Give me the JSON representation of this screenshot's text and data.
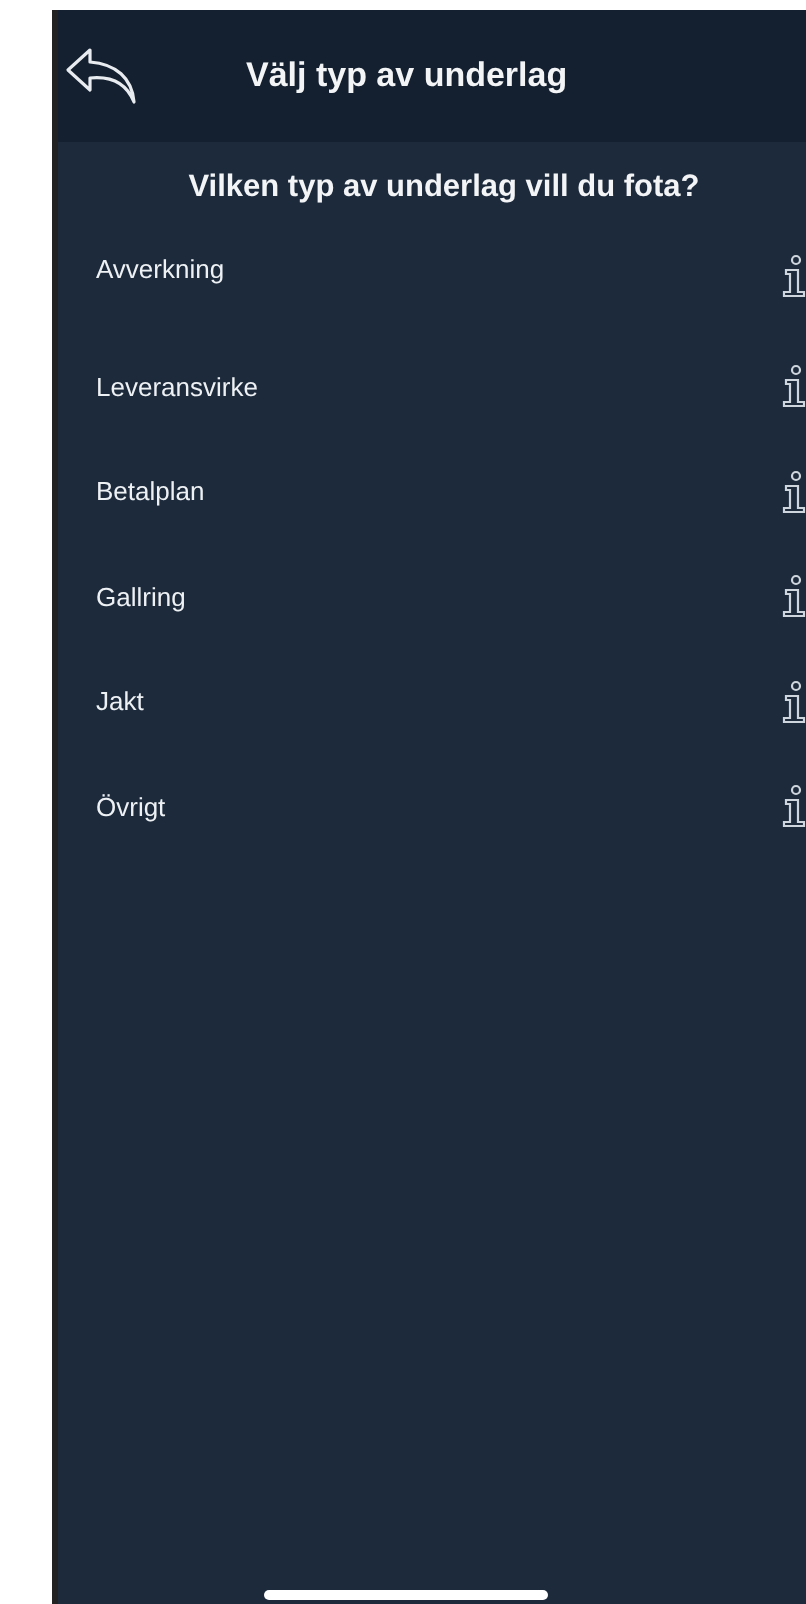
{
  "header": {
    "title": "Välj typ av underlag"
  },
  "question": "Vilken typ av underlag vill du fota?",
  "items": [
    {
      "label": "Avverkning"
    },
    {
      "label": "Leveransvirke"
    },
    {
      "label": "Betalplan"
    },
    {
      "label": "Gallring"
    },
    {
      "label": "Jakt"
    },
    {
      "label": "Övrigt"
    }
  ]
}
